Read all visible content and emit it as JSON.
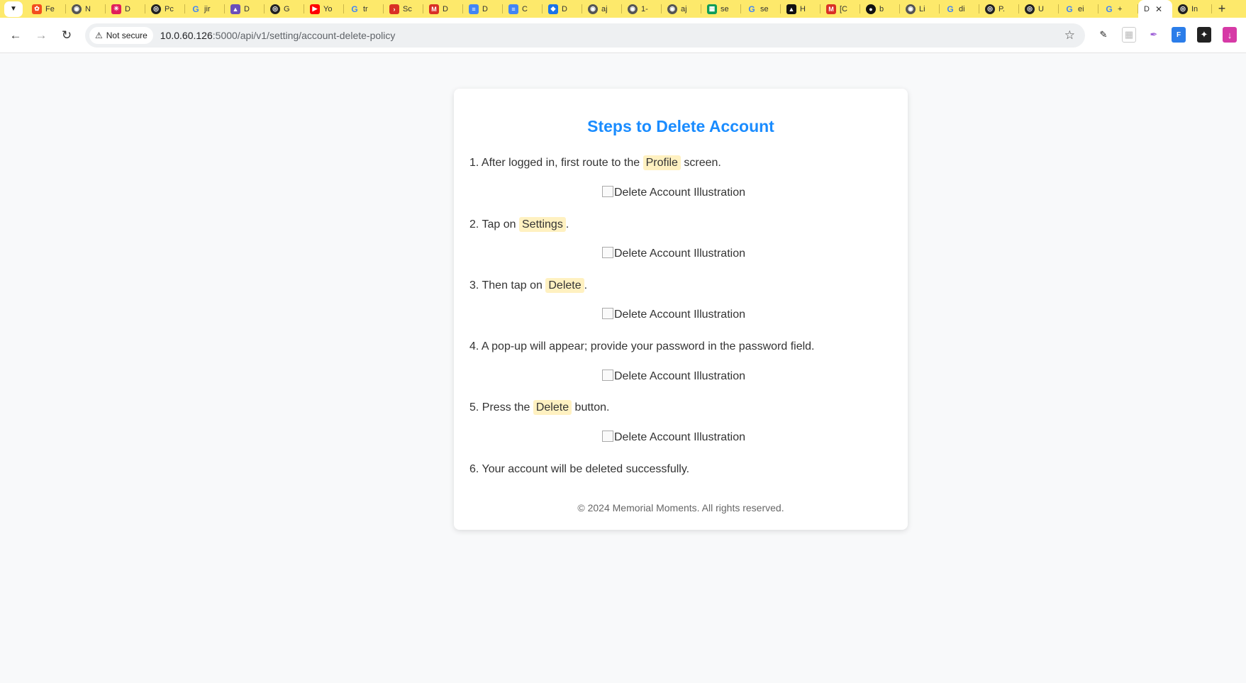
{
  "browser": {
    "tabs": [
      {
        "label": "Fe",
        "icon": "figma-icon",
        "color": "#f24e1e"
      },
      {
        "label": "N",
        "icon": "globe-icon",
        "color": "#555555"
      },
      {
        "label": "D",
        "icon": "slack-icon",
        "color": "#e01e5a"
      },
      {
        "label": "Pc",
        "icon": "openai-icon",
        "color": "#222222"
      },
      {
        "label": "jir",
        "icon": "google-icon",
        "color": "#4285f4"
      },
      {
        "label": "D",
        "icon": "app-icon",
        "color": "#6b4fbb"
      },
      {
        "label": "G",
        "icon": "openai-icon",
        "color": "#222222"
      },
      {
        "label": "Yo",
        "icon": "youtube-icon",
        "color": "#ff0000"
      },
      {
        "label": "tr",
        "icon": "google-icon",
        "color": "#4285f4"
      },
      {
        "label": "Sc",
        "icon": "arrow-icon",
        "color": "#d93025"
      },
      {
        "label": "D",
        "icon": "gmail-icon",
        "color": "#d93025"
      },
      {
        "label": "D",
        "icon": "docs-icon",
        "color": "#4285f4"
      },
      {
        "label": "C",
        "icon": "docs-icon",
        "color": "#4285f4"
      },
      {
        "label": "D",
        "icon": "shield-icon",
        "color": "#1a73e8"
      },
      {
        "label": "aj",
        "icon": "globe-icon",
        "color": "#555555"
      },
      {
        "label": "1-",
        "icon": "globe-icon",
        "color": "#555555"
      },
      {
        "label": "aj",
        "icon": "globe-icon",
        "color": "#555555"
      },
      {
        "label": "se",
        "icon": "sheets-icon",
        "color": "#0f9d58"
      },
      {
        "label": "se",
        "icon": "google-icon",
        "color": "#4285f4"
      },
      {
        "label": "H",
        "icon": "app-icon",
        "color": "#111111"
      },
      {
        "label": "[C",
        "icon": "gmail-icon",
        "color": "#d93025"
      },
      {
        "label": "b",
        "icon": "github-icon",
        "color": "#111111"
      },
      {
        "label": "Li",
        "icon": "globe-icon",
        "color": "#555555"
      },
      {
        "label": "di",
        "icon": "google-icon",
        "color": "#4285f4"
      },
      {
        "label": "P.",
        "icon": "openai-icon",
        "color": "#222222"
      },
      {
        "label": "U",
        "icon": "openai-icon",
        "color": "#222222"
      },
      {
        "label": "ei",
        "icon": "google-icon",
        "color": "#4285f4"
      },
      {
        "label": "+",
        "icon": "google-icon",
        "color": "#4285f4"
      }
    ],
    "active_tab": {
      "label": "D"
    },
    "after_tab": {
      "label": "In",
      "icon": "openai-icon"
    },
    "security_label": "Not secure",
    "url_host": "10.0.60.126",
    "url_path": ":5000/api/v1/setting/account-delete-policy"
  },
  "page": {
    "title": "Steps to Delete Account",
    "image_alt": "Delete Account Illustration",
    "steps": [
      {
        "num": "1.",
        "before": "After logged in, first route to the",
        "highlight": "Profile",
        "after": "screen."
      },
      {
        "num": "2.",
        "before": "Tap on",
        "highlight": "Settings",
        "after": "."
      },
      {
        "num": "3.",
        "before": "Then tap on",
        "highlight": "Delete",
        "after": "."
      },
      {
        "num": "4.",
        "text": "A pop-up will appear; provide your password in the password field."
      },
      {
        "num": "5.",
        "before": "Press the",
        "highlight": "Delete",
        "after": "button."
      },
      {
        "num": "6.",
        "text": "Your account will be deleted successfully."
      }
    ],
    "footer": "© 2024 Memorial Moments. All rights reserved."
  },
  "colors": {
    "tabstrip": "#fde96b",
    "title": "#1a8cff",
    "highlight": "#fff1c1",
    "page_bg": "#f8f9fa"
  }
}
